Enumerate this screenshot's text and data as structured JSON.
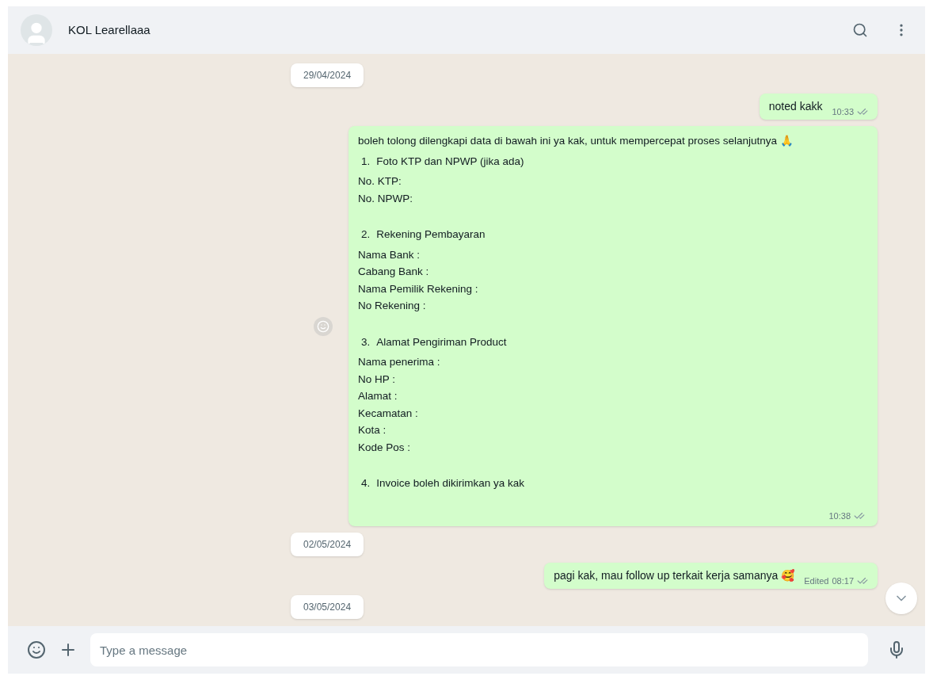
{
  "header": {
    "contact_name": "KOL Learellaaa"
  },
  "messages": [
    {
      "kind": "date",
      "text": "29/04/2024"
    },
    {
      "kind": "outgoing",
      "text": "noted kakk",
      "time": "10:33",
      "edited": false
    },
    {
      "kind": "form",
      "time": "10:38",
      "edited": false,
      "blocks": [
        {
          "kind": "text",
          "lines": [
            "boleh tolong dilengkapi data di bawah ini ya kak, untuk mempercepat proses selanjutnya 🙏"
          ]
        },
        {
          "kind": "item",
          "number": "1.",
          "text": "Foto KTP dan NPWP (jika ada)"
        },
        {
          "kind": "text",
          "lines": [
            "No. KTP:",
            "No. NPWP:"
          ]
        },
        {
          "kind": "item",
          "number": "2.",
          "text": "Rekening Pembayaran"
        },
        {
          "kind": "text",
          "lines": [
            "Nama Bank :",
            "Cabang Bank :",
            "Nama Pemilik Rekening :",
            "No Rekening :"
          ]
        },
        {
          "kind": "item",
          "number": "3.",
          "text": "Alamat Pengiriman Product"
        },
        {
          "kind": "text",
          "lines": [
            "Nama penerima :",
            "No HP :",
            "Alamat :",
            "Kecamatan :",
            "Kota :",
            "Kode Pos :"
          ]
        },
        {
          "kind": "item",
          "number": "4.",
          "text": "Invoice boleh dikirimkan ya kak"
        }
      ]
    },
    {
      "kind": "date",
      "text": "02/05/2024"
    },
    {
      "kind": "outgoing",
      "text": "pagi kak, mau follow up terkait kerja samanya 🥰",
      "time": "08:17",
      "edited": true,
      "edited_label": "Edited"
    },
    {
      "kind": "date",
      "text": "03/05/2024"
    }
  ],
  "composer": {
    "placeholder": "Type a message"
  }
}
